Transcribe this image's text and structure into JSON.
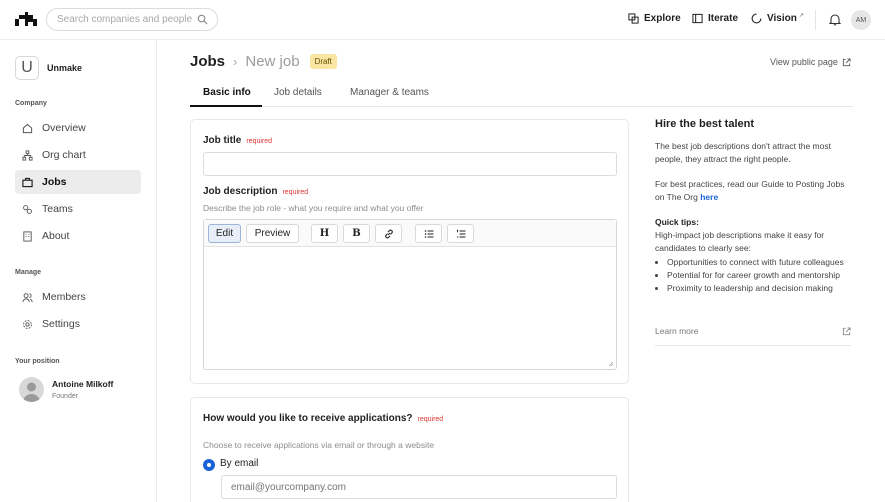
{
  "header": {
    "search_placeholder": "Search companies and people...",
    "nav": [
      {
        "label": "Explore",
        "icon": "explore-icon"
      },
      {
        "label": "Iterate",
        "icon": "book-icon"
      },
      {
        "label": "Vision",
        "icon": "loader-icon",
        "sup": "↗"
      }
    ],
    "avatar_initials": "AM"
  },
  "sidebar": {
    "org_initial": "U",
    "org_name": "Unmake",
    "company_label": "Company",
    "company_items": [
      {
        "label": "Overview",
        "icon": "overview-icon",
        "active": false
      },
      {
        "label": "Org chart",
        "icon": "org-chart-icon",
        "active": false
      },
      {
        "label": "Jobs",
        "icon": "briefcase-icon",
        "active": true
      },
      {
        "label": "Teams",
        "icon": "teams-icon",
        "active": false
      },
      {
        "label": "About",
        "icon": "building-icon",
        "active": false
      }
    ],
    "manage_label": "Manage",
    "manage_items": [
      {
        "label": "Members",
        "icon": "members-icon"
      },
      {
        "label": "Settings",
        "icon": "gear-icon"
      }
    ],
    "position_label": "Your position",
    "position": {
      "name": "Antoine Milkoff",
      "role": "Founder"
    }
  },
  "main": {
    "breadcrumb": {
      "root": "Jobs",
      "current": "New job",
      "badge": "Draft"
    },
    "view_public": "View public page",
    "tabs": [
      "Basic info",
      "Job details",
      "Manager & teams"
    ],
    "active_tab": 0,
    "job_title": {
      "label": "Job title",
      "required": "required",
      "value": ""
    },
    "job_description": {
      "label": "Job description",
      "required": "required",
      "helper": "Describe the job role - what you require and what you offer",
      "toolbar": {
        "edit": "Edit",
        "preview": "Preview",
        "heading": "H",
        "bold": "B"
      },
      "value": ""
    },
    "applications": {
      "label": "How would you like to receive applications?",
      "required": "required",
      "helper": "Choose to receive applications via email or through a website",
      "option": "By email",
      "email_placeholder": "email@yourcompany.com"
    }
  },
  "tips": {
    "title": "Hire the best talent",
    "p1": "The best job descriptions don't attract the most people, they attract the right people.",
    "p2": "For best practices, read our Guide to Posting Jobs on The Org",
    "p2_link": "here",
    "quick_title": "Quick tips:",
    "quick_intro": "High-impact job descriptions make it easy for candidates to clearly see:",
    "bullets": [
      "Opportunities to connect with future colleagues",
      "Potential for for career growth and mentorship",
      "Proximity to leadership and decision making"
    ],
    "learn_more": "Learn more"
  },
  "colors": {
    "accent": "#1a63d6",
    "draft_badge": "#fbe5a3",
    "required": "#dd3333"
  }
}
